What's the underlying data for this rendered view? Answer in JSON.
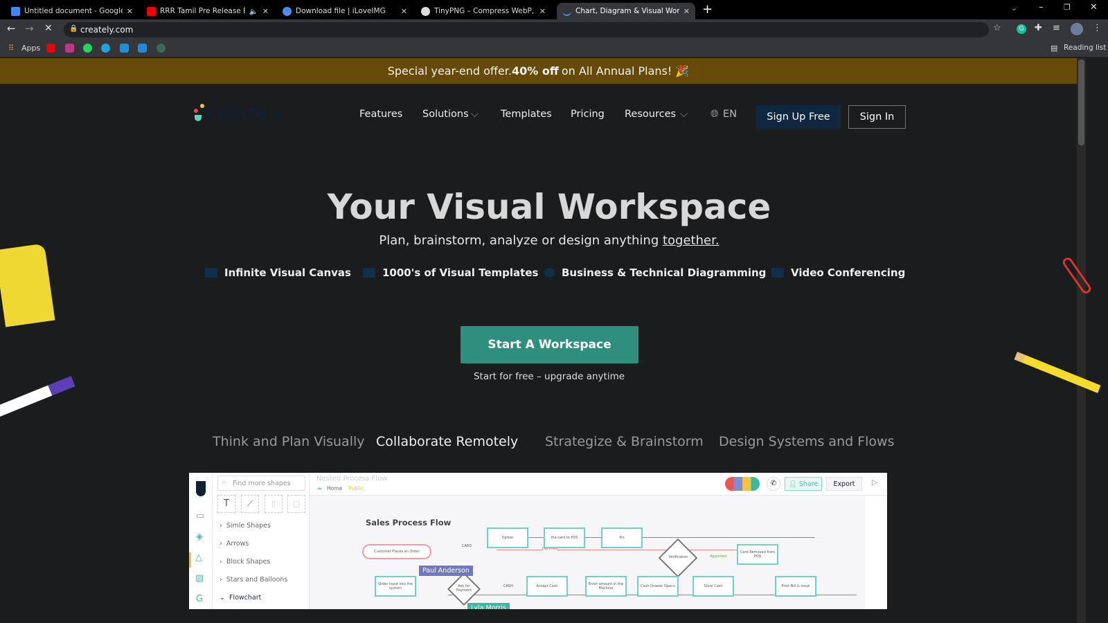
{
  "browser": {
    "tabs": [
      {
        "title": "Untitled document - Google Doc",
        "icon": "google-docs-icon"
      },
      {
        "title": "RRR Tamil Pre Release Event",
        "icon": "youtube-icon"
      },
      {
        "title": "Download file | iLoveIMG",
        "icon": "iloveimg-icon"
      },
      {
        "title": "TinyPNG – Compress WebP, PNG",
        "icon": "tinypng-icon"
      },
      {
        "title": "Chart, Diagram & Visual Workspa",
        "icon": "loading-icon"
      }
    ],
    "url": "creately.com",
    "bookmarks_apps": "Apps",
    "reading_list": "Reading list"
  },
  "banner": {
    "pre": "Special year-end offer. ",
    "bold": "40% off",
    "post": " on All Annual Plans! 🎉"
  },
  "nav": {
    "logo": "creately",
    "items": [
      "Features",
      "Solutions",
      "Templates",
      "Pricing",
      "Resources"
    ],
    "lang": "EN",
    "signup": "Sign Up Free",
    "signin": "Sign In"
  },
  "hero": {
    "title": "Your Visual Workspace",
    "subtitle": "Plan, brainstorm, analyze or design anything ",
    "subtitle_link": "together.",
    "cta": "Start A Workspace",
    "cta_note": "Start for free – upgrade anytime"
  },
  "features": [
    "Infinite Visual Canvas",
    "1000's of Visual Templates",
    "Business & Technical Diagramming",
    "Video Conferencing"
  ],
  "section_tabs": [
    "Think and Plan Visually",
    "Collaborate Remotely",
    "Strategize & Brainstorm",
    "Design Systems and Flows"
  ],
  "app": {
    "search_placeholder": "Find more shapes",
    "doc_title": "Nested Process Flow",
    "breadcrumb_home": "Home",
    "breadcrumb_public": "Public",
    "share": "Share",
    "export": "Export",
    "library": [
      "Simle Shapes",
      "Arrows",
      "Block Shapes",
      "Stars and Balloons",
      "Flowchart"
    ],
    "diagram_title": "Sales Process Flow",
    "nodes": {
      "start": "Customer Places an Order",
      "option": "Option",
      "card_pos": "the card to POS",
      "pin": "Pin",
      "verify": "Verification",
      "card_removed": "Card Removed from POS",
      "order_input": "Order input into the system",
      "ask": "Ask for Payment",
      "accept": "Accept Cash",
      "enter": "Enter amount in the Machine",
      "drawer": "Cash Drawer Opens",
      "store": "Store Cash",
      "print": "Print Bill & Issue"
    },
    "labels": {
      "card": "CARD",
      "cash": "CASH",
      "declined": "Declined",
      "approved": "Approved"
    },
    "cursor_user": "Paul Anderson",
    "cursor_user2": "Lyla Morris"
  },
  "colors": {
    "accent": "#2f8f7f",
    "banner": "#654a08",
    "signup_bg": "#0f2740"
  }
}
